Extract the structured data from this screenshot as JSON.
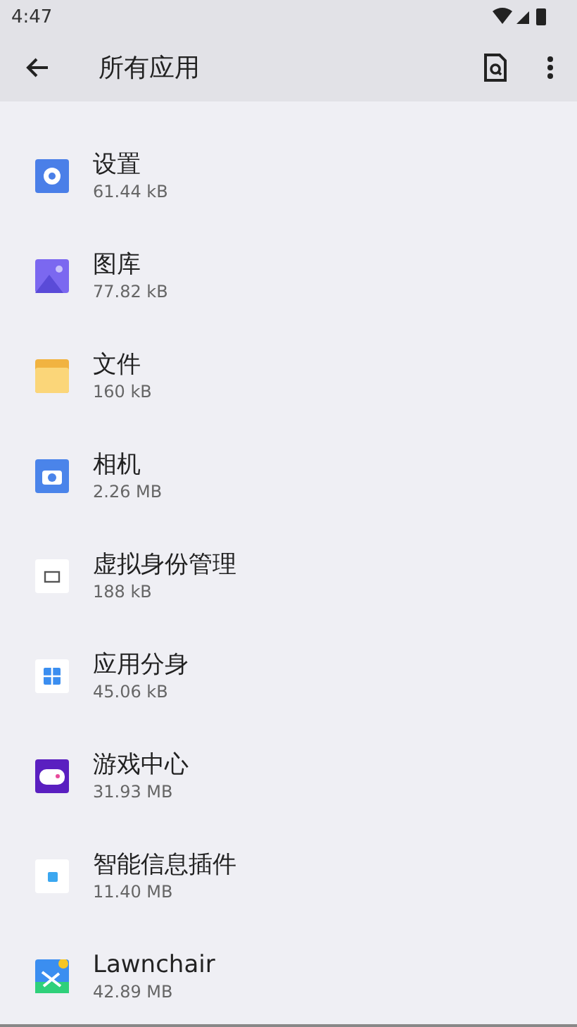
{
  "status_bar": {
    "time": "4:47"
  },
  "app_bar": {
    "title": "所有应用"
  },
  "apps": [
    {
      "kind": "settings",
      "name": "设置",
      "size": "61.44 kB"
    },
    {
      "kind": "gallery",
      "name": "图库",
      "size": "77.82 kB"
    },
    {
      "kind": "files",
      "name": "文件",
      "size": "160 kB"
    },
    {
      "kind": "camera",
      "name": "相机",
      "size": "2.26 MB"
    },
    {
      "kind": "identity",
      "name": "虚拟身份管理",
      "size": "188 kB"
    },
    {
      "kind": "clone",
      "name": "应用分身",
      "size": "45.06 kB"
    },
    {
      "kind": "game",
      "name": "游戏中心",
      "size": "31.93 MB"
    },
    {
      "kind": "widget",
      "name": "智能信息插件",
      "size": "11.40 MB"
    },
    {
      "kind": "launcher",
      "name": "Lawnchair",
      "size": "42.89 MB"
    }
  ]
}
